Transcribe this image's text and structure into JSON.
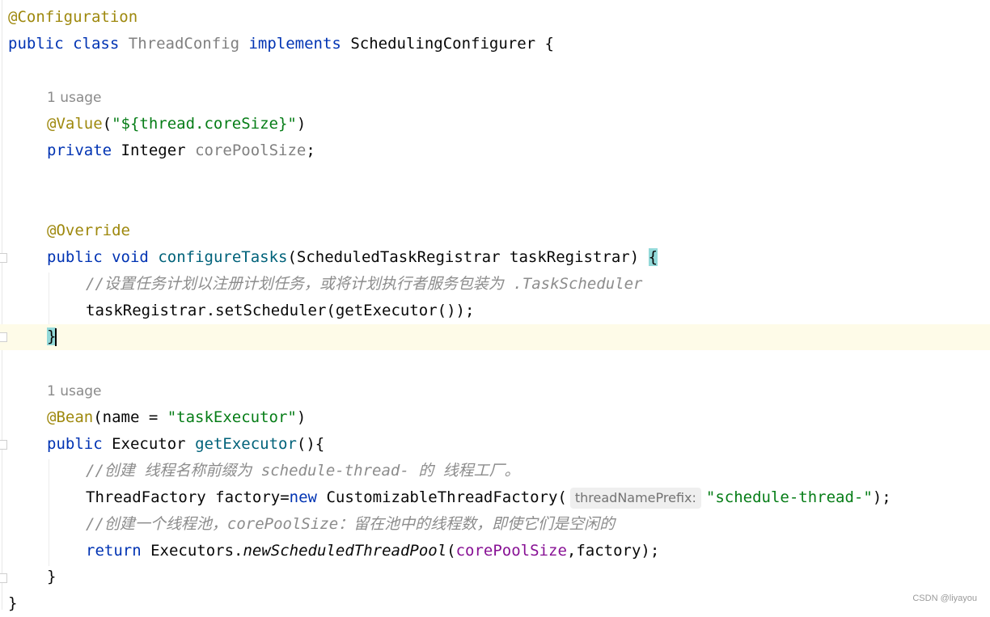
{
  "code": {
    "l1_annotation": "@Configuration",
    "l2_kw_public": "public",
    "l2_kw_class": "class",
    "l2_classname": "ThreadConfig",
    "l2_kw_implements": "implements",
    "l2_interface": "SchedulingConfigurer {",
    "usage_hint_1": "1 usage",
    "l3_annotation": "@Value",
    "l3_paren_open": "(",
    "l3_string": "\"${thread.coreSize}\"",
    "l3_paren_close": ")",
    "l4_kw_private": "private",
    "l4_type": "Integer",
    "l4_field": "corePoolSize",
    "l4_semi": ";",
    "l5_annotation": "@Override",
    "l6_kw_public": "public",
    "l6_kw_void": "void",
    "l6_method": "configureTasks",
    "l6_params": "(ScheduledTaskRegistrar taskRegistrar)",
    "l6_brace": "{",
    "l7_comment": "//设置任务计划以注册计划任务，或将计划执行者服务包装为 .TaskScheduler",
    "l8_code": "taskRegistrar.setScheduler(getExecutor());",
    "l9_brace": "}",
    "usage_hint_2": "1 usage",
    "l10_annotation": "@Bean",
    "l10_open": "(name = ",
    "l10_string": "\"taskExecutor\"",
    "l10_close": ")",
    "l11_kw_public": "public",
    "l11_type": "Executor",
    "l11_method": "getExecutor",
    "l11_rest": "(){",
    "l12_comment": "//创建 线程名称前缀为 schedule-thread- 的 线程工厂。",
    "l13_a": "ThreadFactory factory=",
    "l13_kw_new": "new",
    "l13_b": "CustomizableThreadFactory(",
    "l13_param_hint": "threadNamePrefix:",
    "l13_string": "\"schedule-thread-\"",
    "l13_end": ");",
    "l14_comment": "//创建一个线程池，corePoolSize：留在池中的线程数，即使它们是空闲的",
    "l15_kw_return": "return",
    "l15_a": "Executors.",
    "l15_method": "newScheduledThreadPool",
    "l15_open": "(",
    "l15_field": "corePoolSize",
    "l15_end": ",factory);",
    "l16_brace": "}",
    "l17_brace": "}"
  },
  "watermark": "CSDN @liyayou",
  "colors": {
    "annotation": "#9e880d",
    "keyword": "#0033b3",
    "string": "#067d17",
    "field": "#871094",
    "method": "#00627a",
    "comment": "#8c8c8c",
    "current_line": "#fefbe8",
    "brace_match": "#93d9d9"
  }
}
